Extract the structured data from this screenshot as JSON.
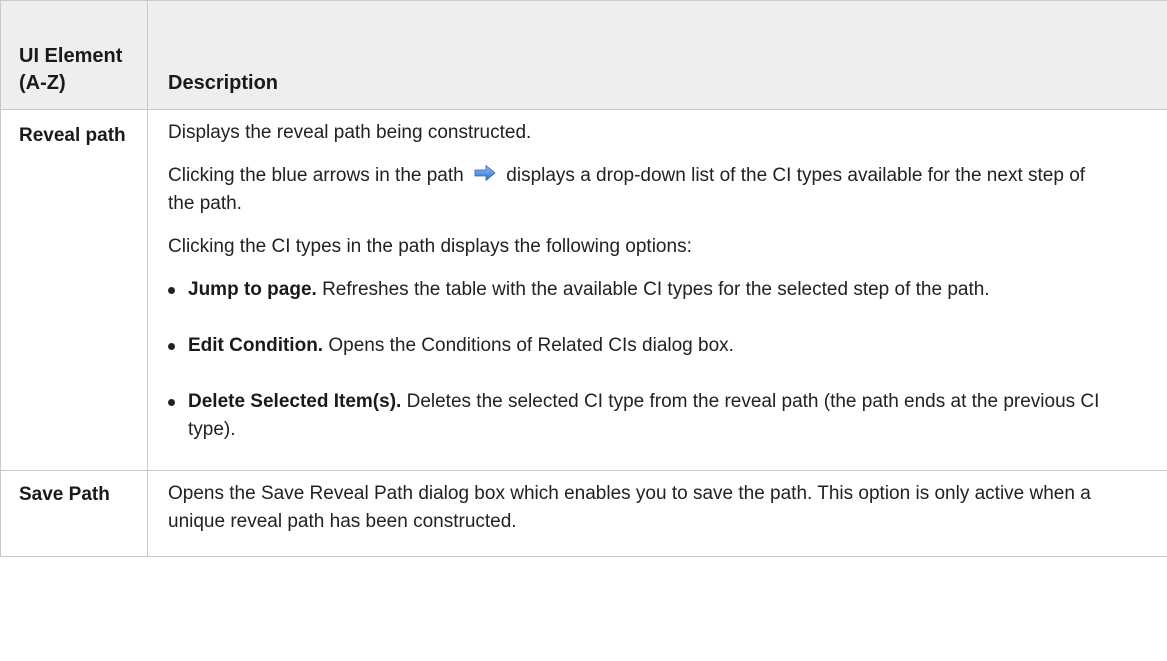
{
  "table": {
    "headers": {
      "element": "UI Element (A-Z)",
      "description": "Description"
    },
    "rows": [
      {
        "term": "Reveal path",
        "para1": "Displays the reveal path being constructed.",
        "para2_before": "Clicking the blue arrows in the path",
        "para2_after": "displays a drop-down list of the CI types available for the next step of the path.",
        "para2_icon": "blue-arrow-icon",
        "para3": "Clicking the CI types in the path displays the following options:",
        "options": [
          {
            "label": "Jump to page.",
            "text": "Refreshes the table with the available CI types for the selected step of the path."
          },
          {
            "label": "Edit Condition.",
            "text": "Opens the Conditions of Related CIs dialog box."
          },
          {
            "label": "Delete Selected Item(s).",
            "text": "Deletes the selected CI type from the reveal path (the path ends at the previous CI type)."
          }
        ]
      },
      {
        "term": "Save Path",
        "description": "Opens the Save Reveal Path dialog box which enables you to save the path. This option is only active when a unique reveal path has been constructed."
      }
    ]
  },
  "colors": {
    "header_bg": "#eeeeee",
    "border": "#c9c9c9",
    "arrow": "#3d7fd6"
  }
}
